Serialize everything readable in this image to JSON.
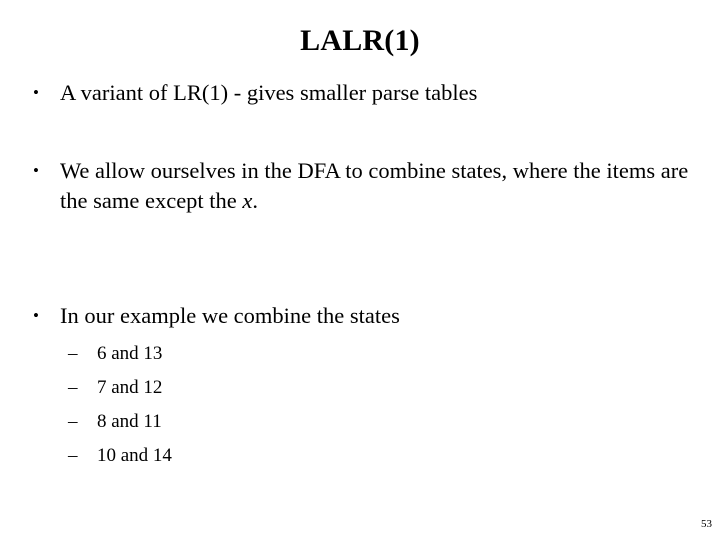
{
  "slide": {
    "title": "LALR(1)",
    "page_number": "53",
    "background_color": "#ffffff",
    "text_color": "#000000",
    "bullet_marker": "•",
    "sub_bullet_marker": "–",
    "bullets": [
      {
        "text": "A variant of LR(1) - gives smaller parse tables"
      },
      {
        "text_before_italic": "We allow ourselves in the DFA to combine states, where the items are the same except the ",
        "italic_text": "x",
        "text_after_italic": "."
      },
      {
        "text": "In our example we combine the states",
        "sub_items": [
          "6 and 13",
          "7 and 12",
          "8 and 11",
          "10 and 14"
        ]
      }
    ]
  }
}
